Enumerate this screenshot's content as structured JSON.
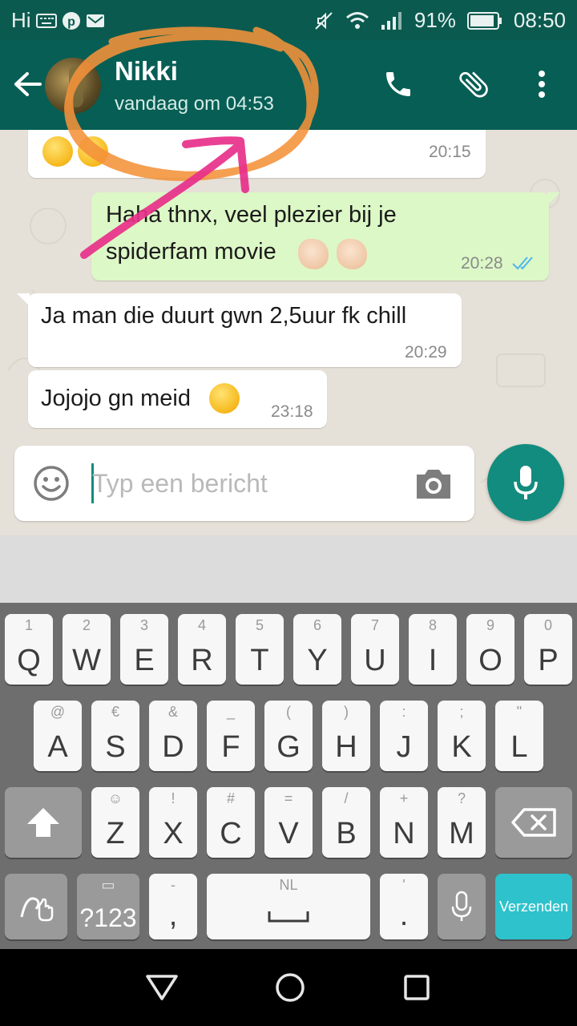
{
  "status_bar": {
    "carrier_text": "Hi",
    "battery_percent": "91%",
    "battery_level": 0.91,
    "time": "08:50",
    "icons": [
      "keyboard-icon",
      "pinterest-icon",
      "mail-icon",
      "mute-icon",
      "wifi-icon",
      "signal-icon",
      "battery-icon"
    ]
  },
  "header": {
    "contact_name": "Nikki",
    "last_seen": "vandaag om 04:53",
    "icons": [
      "back-arrow-icon",
      "phone-icon",
      "paperclip-icon",
      "more-vert-icon"
    ]
  },
  "messages": [
    {
      "direction": "incoming",
      "text": "",
      "emojis": [
        "smirk-emoji",
        "smirk-emoji"
      ],
      "time": "20:15"
    },
    {
      "direction": "outgoing",
      "line1": "Haha thnx, veel plezier bij je",
      "line2": "spiderfam movie",
      "emojis": [
        "ok-hand-emoji",
        "ok-hand-emoji"
      ],
      "time": "20:28",
      "status": "read"
    },
    {
      "direction": "incoming",
      "text": "Ja man die duurt gwn 2,5uur fk chill",
      "time": "20:29"
    },
    {
      "direction": "incoming",
      "text": "Jojojo gn meid",
      "emojis": [
        "kiss-emoji"
      ],
      "time": "23:18"
    }
  ],
  "composer": {
    "placeholder": "Typ een bericht",
    "value": ""
  },
  "keyboard": {
    "row1": [
      {
        "hint": "1",
        "key": "Q"
      },
      {
        "hint": "2",
        "key": "W"
      },
      {
        "hint": "3",
        "key": "E"
      },
      {
        "hint": "4",
        "key": "R"
      },
      {
        "hint": "5",
        "key": "T"
      },
      {
        "hint": "6",
        "key": "Y"
      },
      {
        "hint": "7",
        "key": "U"
      },
      {
        "hint": "8",
        "key": "I"
      },
      {
        "hint": "9",
        "key": "O"
      },
      {
        "hint": "0",
        "key": "P"
      }
    ],
    "row2": [
      {
        "hint": "@",
        "key": "A"
      },
      {
        "hint": "€",
        "key": "S"
      },
      {
        "hint": "&",
        "key": "D"
      },
      {
        "hint": "_",
        "key": "F"
      },
      {
        "hint": "(",
        "key": "G"
      },
      {
        "hint": ")",
        "key": "H"
      },
      {
        "hint": ":",
        "key": "J"
      },
      {
        "hint": ";",
        "key": "K"
      },
      {
        "hint": "\"",
        "key": "L"
      }
    ],
    "row3": [
      {
        "hint": "☺",
        "key": "Z"
      },
      {
        "hint": "!",
        "key": "X"
      },
      {
        "hint": "#",
        "key": "C"
      },
      {
        "hint": "=",
        "key": "V"
      },
      {
        "hint": "/",
        "key": "B"
      },
      {
        "hint": "+",
        "key": "N"
      },
      {
        "hint": "?",
        "key": "M"
      }
    ],
    "symbols_label": "?123",
    "comma_hint": "-",
    "comma_key": ",",
    "space_hint": "NL",
    "period_hint": "'",
    "period_key": ".",
    "send_label": "Verzenden"
  },
  "colors": {
    "header": "#075e54",
    "statusbar": "#0b5a4f",
    "outgoing_bubble": "#dcf8c6",
    "accent": "#128c7e",
    "send_key": "#2ec2cc",
    "annotation_orange": "#f4923a",
    "annotation_pink": "#e8308a"
  }
}
